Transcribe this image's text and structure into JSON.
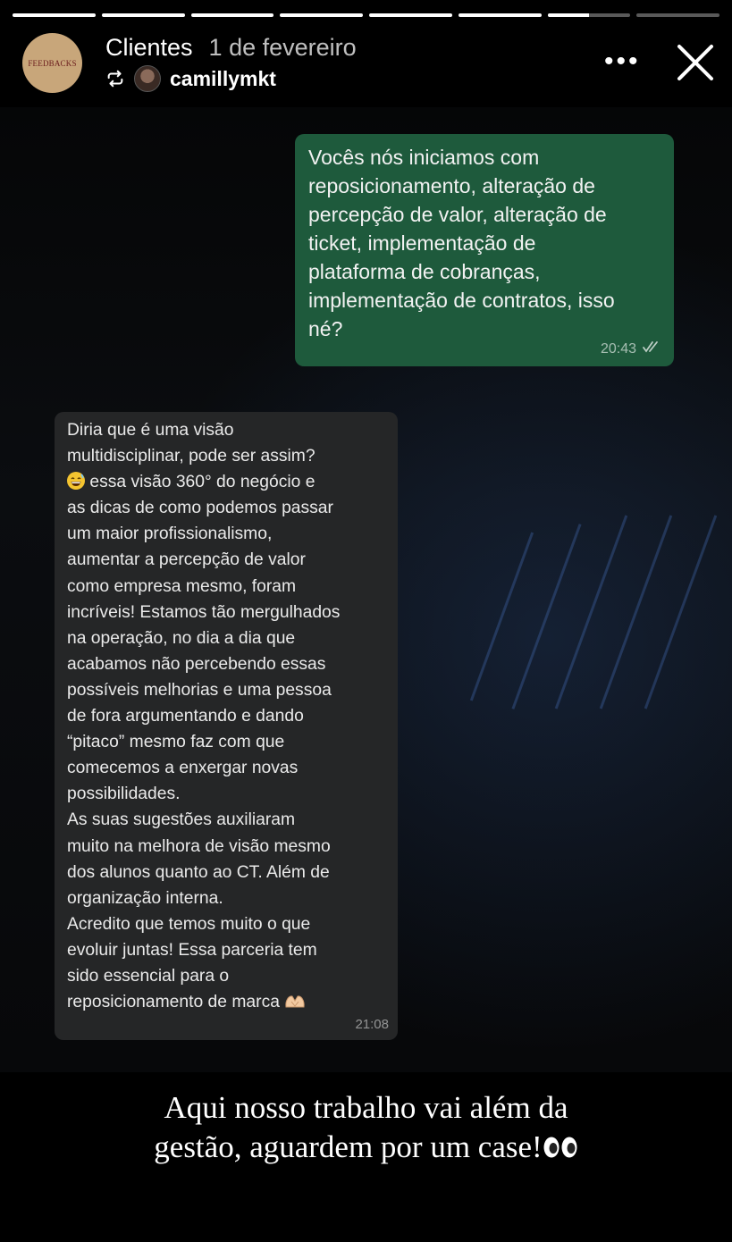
{
  "story": {
    "segments": [
      1,
      1,
      1,
      1,
      1,
      1,
      0.5,
      0
    ],
    "title": "Clientes",
    "date": "1 de fevereiro",
    "avatar_text": "FEEDBACKS",
    "repost_user": "camillymkt",
    "more_label": "•••"
  },
  "chat": {
    "outgoing": {
      "lines": [
        "Vocês nós iniciamos com",
        "reposicionamento, alteração de",
        "percepção de valor, alteração de",
        "ticket, implementação de",
        "plataforma de cobranças,",
        "implementação de contratos, isso",
        "né?"
      ],
      "time": "20:43"
    },
    "incoming": {
      "lines": [
        "Diria que é uma visão",
        "multidisciplinar, pode ser assim?",
        "essa visão 360° do negócio e",
        "as dicas de como podemos passar",
        "um maior profissionalismo,",
        "aumentar a percepção de valor",
        "como empresa mesmo, foram",
        "incríveis! Estamos tão mergulhados",
        "na operação, no dia a dia que",
        "acabamos não percebendo essas",
        "possíveis melhorias e uma pessoa",
        "de fora argumentando e dando",
        "“pitaco” mesmo faz com que",
        "comecemos a enxergar novas",
        "possibilidades.",
        "As suas sugestões auxiliaram",
        "muito na melhora de visão mesmo",
        "dos alunos quanto ao CT. Além de",
        "organização interna.",
        "Acredito que temos muito o que",
        "evoluir juntas! Essa parceria tem",
        "sido essencial para o",
        "reposicionamento de marca"
      ],
      "time": "21:08"
    }
  },
  "caption": {
    "line1": "Aqui nosso trabalho vai além da",
    "line2": "gestão, aguardem por um case!"
  },
  "colors": {
    "outgoing_bubble": "#1e5a3c",
    "incoming_bubble": "#252627",
    "avatar_bg": "#c8a67a"
  }
}
